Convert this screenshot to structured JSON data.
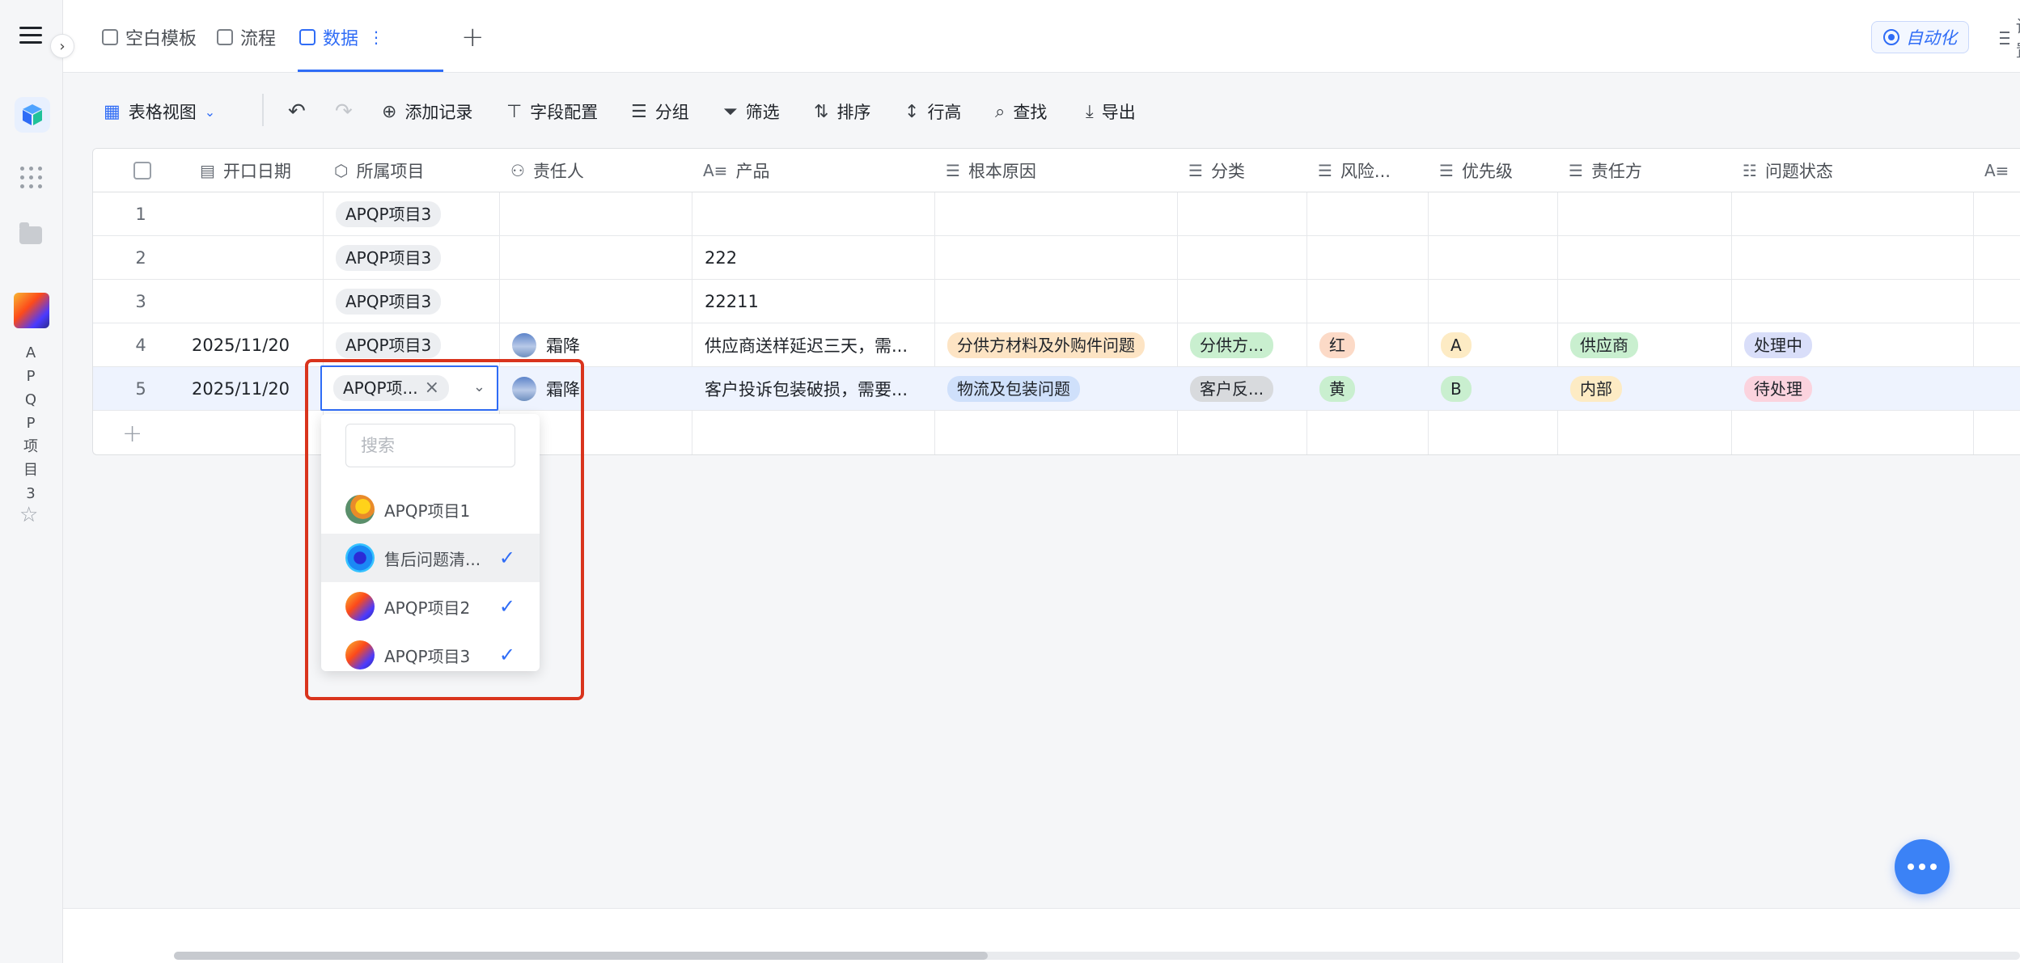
{
  "app": {
    "sidebar_vertical_name": "APQP项目3"
  },
  "tabs": [
    {
      "label": "空白模板"
    },
    {
      "label": "流程"
    },
    {
      "label": "数据",
      "more": "⋮"
    }
  ],
  "header": {
    "automation_label": "自动化",
    "settings_label": "设置"
  },
  "toolbar": {
    "view_label": "表格视图",
    "add_record": "添加记录",
    "field_config": "字段配置",
    "group": "分组",
    "filter": "筛选",
    "sort": "排序",
    "row_height": "行高",
    "find": "查找",
    "export": "导出"
  },
  "table": {
    "columns": [
      "开口日期",
      "所属项目",
      "责任人",
      "产品",
      "根本原因",
      "分类",
      "风险...",
      "优先级",
      "责任方",
      "问题状态"
    ],
    "rows": [
      {
        "num": "1",
        "date": "",
        "project": "APQP项目3",
        "owner": "",
        "product": "",
        "cause": "",
        "category": "",
        "risk": "",
        "priority": "",
        "party": "",
        "status": ""
      },
      {
        "num": "2",
        "date": "",
        "project": "APQP项目3",
        "owner": "",
        "product": "222",
        "cause": "",
        "category": "",
        "risk": "",
        "priority": "",
        "party": "",
        "status": ""
      },
      {
        "num": "3",
        "date": "",
        "project": "APQP项目3",
        "owner": "",
        "product": "22211",
        "cause": "",
        "category": "",
        "risk": "",
        "priority": "",
        "party": "",
        "status": ""
      },
      {
        "num": "4",
        "date": "2025/11/20",
        "project": "APQP项目3",
        "owner": "霜降",
        "product": "供应商送样延迟三天，需...",
        "cause": "分供方材料及外购件问题",
        "category": "分供方...",
        "risk": "红",
        "priority": "A",
        "party": "供应商",
        "status": "处理中"
      },
      {
        "num": "5",
        "date": "2025/11/20",
        "project": "APQP项...",
        "owner": "霜降",
        "product": "客户投诉包装破损，需要...",
        "cause": "物流及包装问题",
        "category": "客户反...",
        "risk": "黄",
        "priority": "B",
        "party": "内部",
        "status": "待处理"
      }
    ]
  },
  "dropdown": {
    "search_placeholder": "搜索",
    "options": [
      {
        "label": "APQP项目1",
        "checked": false
      },
      {
        "label": "售后问题清...",
        "checked": true
      },
      {
        "label": "APQP项目2",
        "checked": true
      },
      {
        "label": "APQP项目3",
        "checked": true
      }
    ]
  },
  "colors": {
    "accent": "#2f6cf6",
    "highlight_box": "#d9341d"
  }
}
